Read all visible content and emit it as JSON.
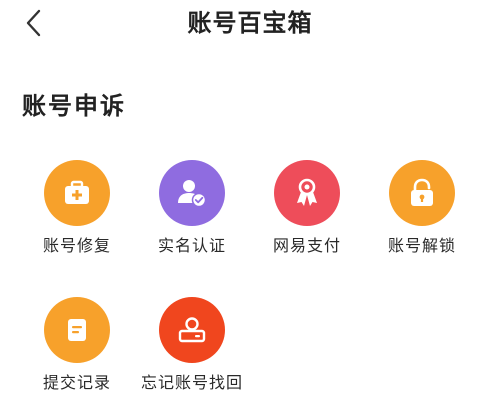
{
  "header": {
    "title": "账号百宝箱",
    "back_icon": "chevron-left-icon"
  },
  "section": {
    "title": "账号申诉",
    "items": [
      {
        "label": "账号修复",
        "icon": "medical-kit-icon",
        "color": "#F7A12B"
      },
      {
        "label": "实名认证",
        "icon": "user-verified-icon",
        "color": "#8F6CE0"
      },
      {
        "label": "网易支付",
        "icon": "payment-ribbon-icon",
        "color": "#EE4D5A"
      },
      {
        "label": "账号解锁",
        "icon": "unlock-icon",
        "color": "#F7A12B"
      },
      {
        "label": "提交记录",
        "icon": "document-icon",
        "color": "#F7A12B"
      },
      {
        "label": "忘记账号找回",
        "icon": "id-card-icon",
        "color": "#F0461E"
      }
    ]
  }
}
